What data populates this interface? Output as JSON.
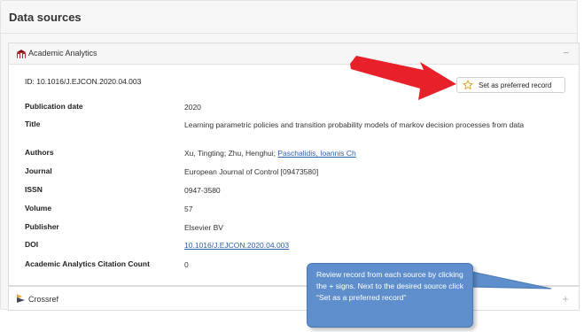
{
  "panel": {
    "title": "Data sources"
  },
  "sources": [
    {
      "name": "Academic Analytics",
      "collapse_symbol": "−",
      "logo_icon": "academic-analytics-logo-icon",
      "record_id": "ID: 10.1016/J.EJCON.2020.04.003",
      "preferred_button": {
        "label": "Set as preferred record",
        "icon": "star-outline-icon"
      },
      "fields": [
        {
          "label": "Publication date",
          "value": "2020"
        },
        {
          "label": "Title",
          "value": "Learning parametric policies and transition probability models of markov decision processes from data"
        },
        {
          "label": "Authors",
          "value_prefix": "Xu, Tingting; Zhu, Henghui; ",
          "value_link": "Paschalidis, Ioannis Ch"
        },
        {
          "label": "Journal",
          "value": "European Journal of Control [09473580]"
        },
        {
          "label": "ISSN",
          "value": "0947-3580"
        },
        {
          "label": "Volume",
          "value": "57"
        },
        {
          "label": "Publisher",
          "value": "Elsevier BV"
        },
        {
          "label": "DOI",
          "value_link": "10.1016/J.EJCON.2020.04.003"
        },
        {
          "label": "Academic Analytics Citation Count",
          "value": "0"
        }
      ]
    },
    {
      "name": "Crossref",
      "expand_symbol": "+",
      "logo_icon": "crossref-logo-icon"
    }
  ],
  "annotation": {
    "callout_text": "Review record from each source by clicking the + signs. Next to the desired source click “Set as a preferred record”",
    "arrow_color": "#e8202a",
    "callout_color": "#5e8fcc"
  }
}
